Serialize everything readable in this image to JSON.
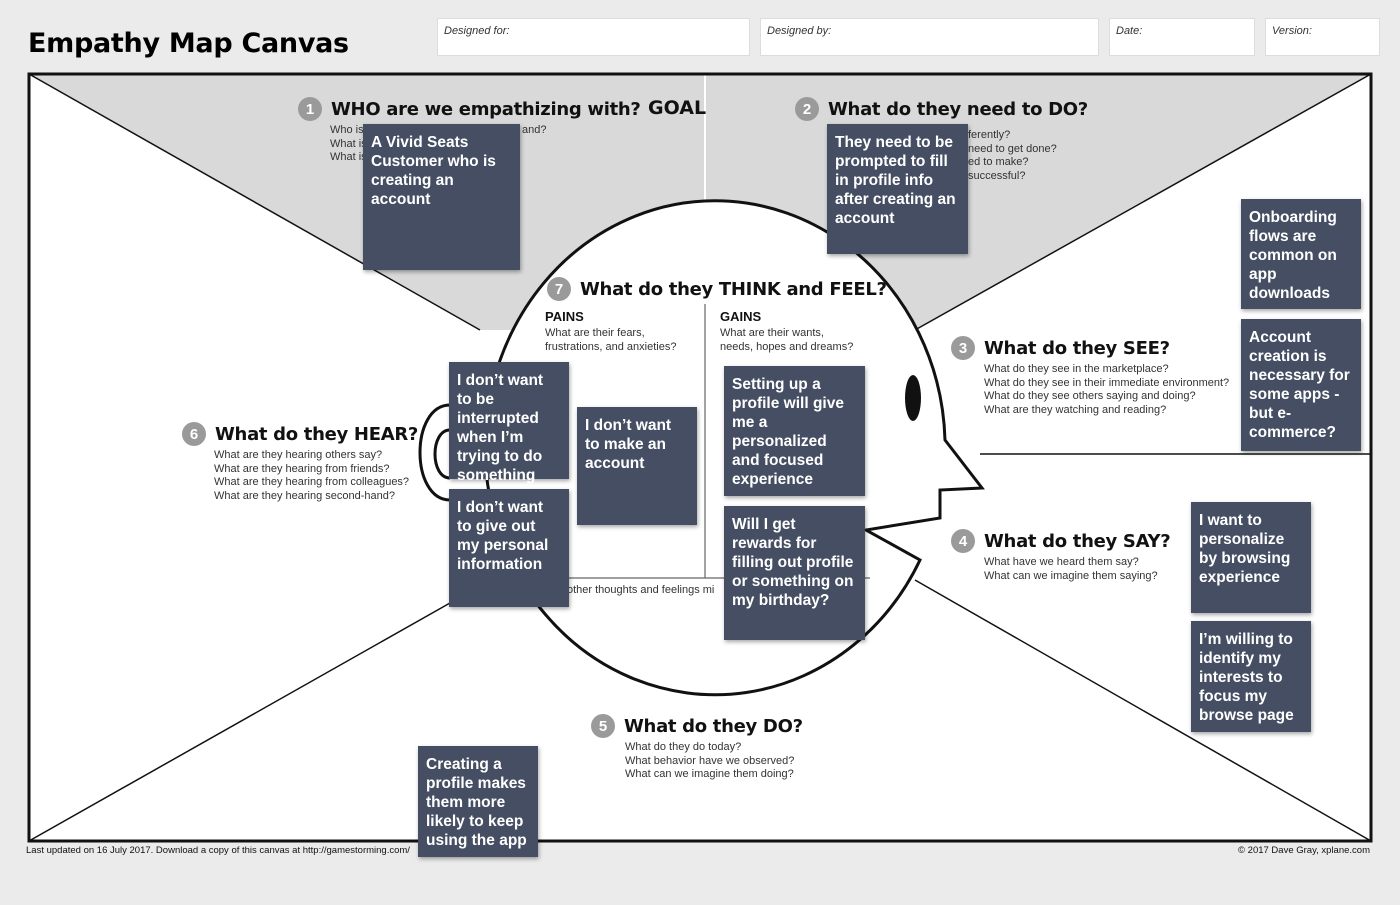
{
  "title": "Empathy Map Canvas",
  "fields": {
    "designed_for": "Designed for:",
    "designed_by": "Designed by:",
    "date": "Date:",
    "version": "Version:"
  },
  "goal": "GOAL",
  "sections": {
    "who": {
      "num": "1",
      "heading": "WHO are we empathizing with?",
      "subs": [
        "Who is",
        "What is",
        "What is"
      ],
      "subs_tail": "and?"
    },
    "need": {
      "num": "2",
      "heading": "What do they need to DO?",
      "subs": [
        "ferently?",
        "need to get done?",
        "ed to make?",
        "successful?"
      ]
    },
    "see": {
      "num": "3",
      "heading": "What do they SEE?",
      "subs": [
        "What do they see in the marketplace?",
        "What do they see in their immediate environment?",
        "What do they see others saying and doing?",
        "What are they watching and reading?"
      ]
    },
    "say": {
      "num": "4",
      "heading": "What do they SAY?",
      "subs": [
        "What have we heard them say?",
        "What can we imagine them saying?"
      ]
    },
    "do": {
      "num": "5",
      "heading": "What do they DO?",
      "subs": [
        "What do they do today?",
        "What behavior have we observed?",
        "What can we imagine them doing?"
      ]
    },
    "hear": {
      "num": "6",
      "heading": "What do they HEAR?",
      "subs": [
        "What are they hearing others say?",
        "What are they hearing from friends?",
        "What are they hearing from colleagues?",
        "What are they hearing second-hand?"
      ]
    },
    "think": {
      "num": "7",
      "heading": "What do they THINK and FEEL?",
      "pains_label": "PAINS",
      "pains_desc": [
        "What are their fears,",
        "frustrations, and anxieties?"
      ],
      "gains_label": "GAINS",
      "gains_desc": [
        "What are their wants,",
        "needs, hopes and dreams?"
      ],
      "other": "other thoughts and feelings mi"
    }
  },
  "stickies": {
    "who": "A Vivid Seats Customer who is creating an account",
    "need": "They need to be prompted to fill in profile info after creating an account",
    "see1": "Onboarding flows are common on app downloads",
    "see2": "Account creation is necessary for some apps - but e-commerce?",
    "say1": "I want to personalize by browsing experience",
    "say2": "I’m willing to identify my interests to focus my browse page",
    "pain1": "I don’t want to be interrupted when I’m trying to do something",
    "pain2": "I don’t want to make an account",
    "pain3": "I don’t want to give out my personal information",
    "gain1": "Setting up a profile will give me a personalized and focused experience",
    "gain2": "Will I get rewards for filling out profile or something on my birthday?",
    "do1": "Creating a profile makes them more likely to keep using the app"
  },
  "footer": {
    "left": "Last updated on 16 July 2017. Download a copy of this canvas at http://gamestorming.com/",
    "right": "© 2017 Dave Gray, xplane.com"
  },
  "colors": {
    "sticky": "#454e62",
    "goal_bg": "#d9d9d9",
    "number_badge": "#9a9a9a"
  }
}
